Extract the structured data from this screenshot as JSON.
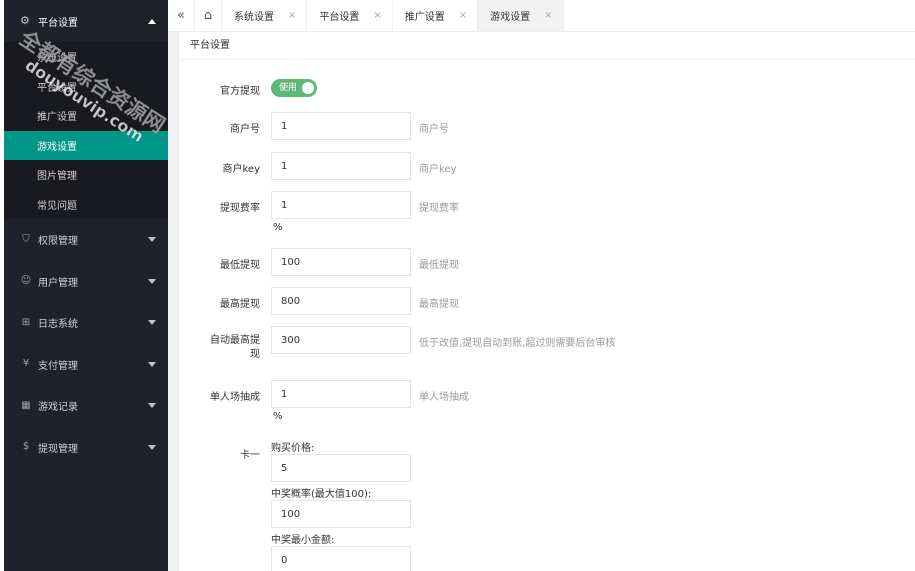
{
  "sidebar": {
    "header": {
      "label": "平台设置",
      "icon": "gear-icon"
    },
    "sub_items": [
      {
        "label": "系统设置",
        "active": false
      },
      {
        "label": "平台设置",
        "active": false
      },
      {
        "label": "推广设置",
        "active": false
      },
      {
        "label": "游戏设置",
        "active": true
      },
      {
        "label": "图片管理",
        "active": false
      },
      {
        "label": "常见问题",
        "active": false
      }
    ],
    "groups": [
      {
        "label": "权限管理",
        "icon": "shield-icon"
      },
      {
        "label": "用户管理",
        "icon": "user-icon"
      },
      {
        "label": "日志系统",
        "icon": "log-icon"
      },
      {
        "label": "支付管理",
        "icon": "yen-icon"
      },
      {
        "label": "游戏记录",
        "icon": "game-icon"
      },
      {
        "label": "提现管理",
        "icon": "dollar-icon"
      }
    ]
  },
  "tabs": [
    {
      "label": "系统设置",
      "close": "×"
    },
    {
      "label": "平台设置",
      "close": "×"
    },
    {
      "label": "推广设置",
      "close": "×"
    },
    {
      "label": "游戏设置",
      "close": "×",
      "active": true
    }
  ],
  "toolbar": {
    "collapse_icon": "«",
    "home_icon": "⌂"
  },
  "page": {
    "title": "平台设置"
  },
  "form": {
    "official_withdraw": {
      "label": "官方提现",
      "switch_text": "使用",
      "on": true
    },
    "merchant_no": {
      "label": "商户号",
      "value": "1",
      "hint": "商户号"
    },
    "merchant_key": {
      "label": "商户key",
      "value": "1",
      "hint": "商户key"
    },
    "withdraw_fee": {
      "label": "提现费率",
      "value": "1",
      "hint": "提现费率",
      "unit": "%"
    },
    "min_withdraw": {
      "label": "最低提现",
      "value": "100",
      "hint": "最低提现"
    },
    "max_withdraw": {
      "label": "最高提现",
      "value": "800",
      "hint": "最高提现"
    },
    "auto_max_withdraw": {
      "label_line1": "自动最高提",
      "label_line2": "现",
      "value": "300",
      "hint": "低于改值,提现自动到账,超过则需要后台审核"
    },
    "single_commission": {
      "label": "单人场抽成",
      "value": "1",
      "hint": "单人场抽成",
      "unit": "%"
    },
    "card_one": {
      "label": "卡一",
      "price_label": "购买价格:",
      "price_value": "5",
      "prob_label": "中奖概率(最大值100):",
      "prob_value": "100",
      "min_amount_label": "中奖最小金额:",
      "min_amount_value": "0"
    }
  },
  "watermark": {
    "line1": "全都有综合资源网",
    "line2": "douyouvip.com"
  },
  "colors": {
    "sidebar_bg": "#20222a",
    "active_green": "#009688",
    "switch_green": "#5fb878"
  }
}
